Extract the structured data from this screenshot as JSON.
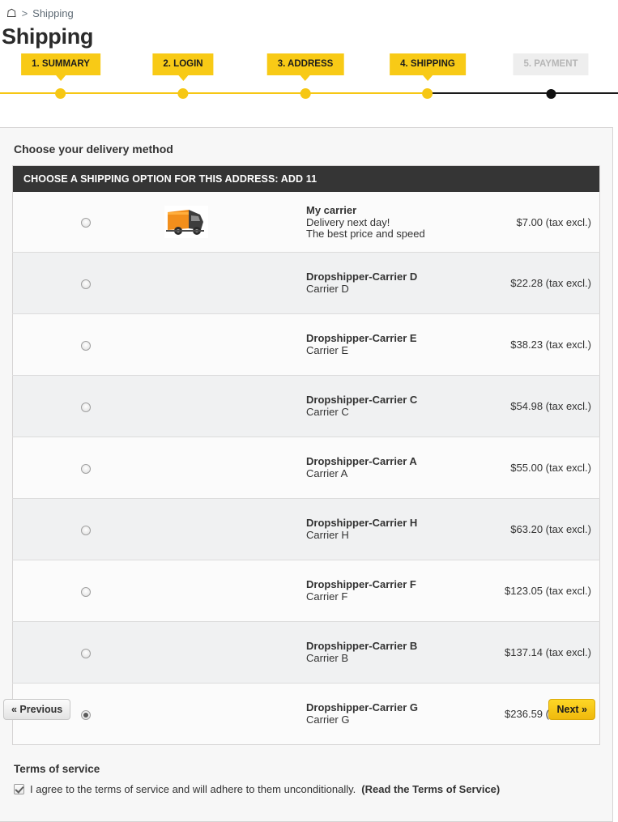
{
  "breadcrumb": {
    "home_icon": "home-icon",
    "separator": ">",
    "current": "Shipping"
  },
  "page_title": "Shipping",
  "steps": [
    {
      "label": "1. SUMMARY",
      "state": "done"
    },
    {
      "label": "2. LOGIN",
      "state": "done"
    },
    {
      "label": "3. ADDRESS",
      "state": "done"
    },
    {
      "label": "4. SHIPPING",
      "state": "current"
    },
    {
      "label": "5. PAYMENT",
      "state": "inactive"
    }
  ],
  "colors": {
    "accent_yellow": "#f8ca16",
    "line_yellow": "#f6c714",
    "line_dark": "#1a1a1a",
    "header_dark": "#353535",
    "inactive_grey": "#eeeeee",
    "inactive_text": "#b6b6b6"
  },
  "delivery": {
    "heading": "Choose your delivery method",
    "table_header": "CHOOSE A SHIPPING OPTION FOR THIS ADDRESS: ADD 11",
    "carriers": [
      {
        "name": "My carrier",
        "delay": "Delivery next day!",
        "extra": "The best price and speed",
        "price": "$7.00 (tax excl.)",
        "selected": false,
        "logo": "delivery-truck-icon"
      },
      {
        "name": "Dropshipper-Carrier D",
        "delay": "Carrier D",
        "price": "$22.28 (tax excl.)",
        "selected": false
      },
      {
        "name": "Dropshipper-Carrier E",
        "delay": "Carrier E",
        "price": "$38.23 (tax excl.)",
        "selected": false
      },
      {
        "name": "Dropshipper-Carrier C",
        "delay": "Carrier C",
        "price": "$54.98 (tax excl.)",
        "selected": false
      },
      {
        "name": "Dropshipper-Carrier A",
        "delay": "Carrier A",
        "price": "$55.00 (tax excl.)",
        "selected": false
      },
      {
        "name": "Dropshipper-Carrier H",
        "delay": "Carrier H",
        "price": "$63.20 (tax excl.)",
        "selected": false
      },
      {
        "name": "Dropshipper-Carrier F",
        "delay": "Carrier F",
        "price": "$123.05 (tax excl.)",
        "selected": false
      },
      {
        "name": "Dropshipper-Carrier B",
        "delay": "Carrier B",
        "price": "$137.14 (tax excl.)",
        "selected": false
      },
      {
        "name": "Dropshipper-Carrier G",
        "delay": "Carrier G",
        "price": "$236.59 (tax excl.)",
        "selected": true
      }
    ]
  },
  "terms": {
    "title": "Terms of service",
    "checked": true,
    "text": "I agree to the terms of service and will adhere to them unconditionally.",
    "link": "(Read the Terms of Service)"
  },
  "footer": {
    "previous": "« Previous",
    "next": "Next »"
  }
}
